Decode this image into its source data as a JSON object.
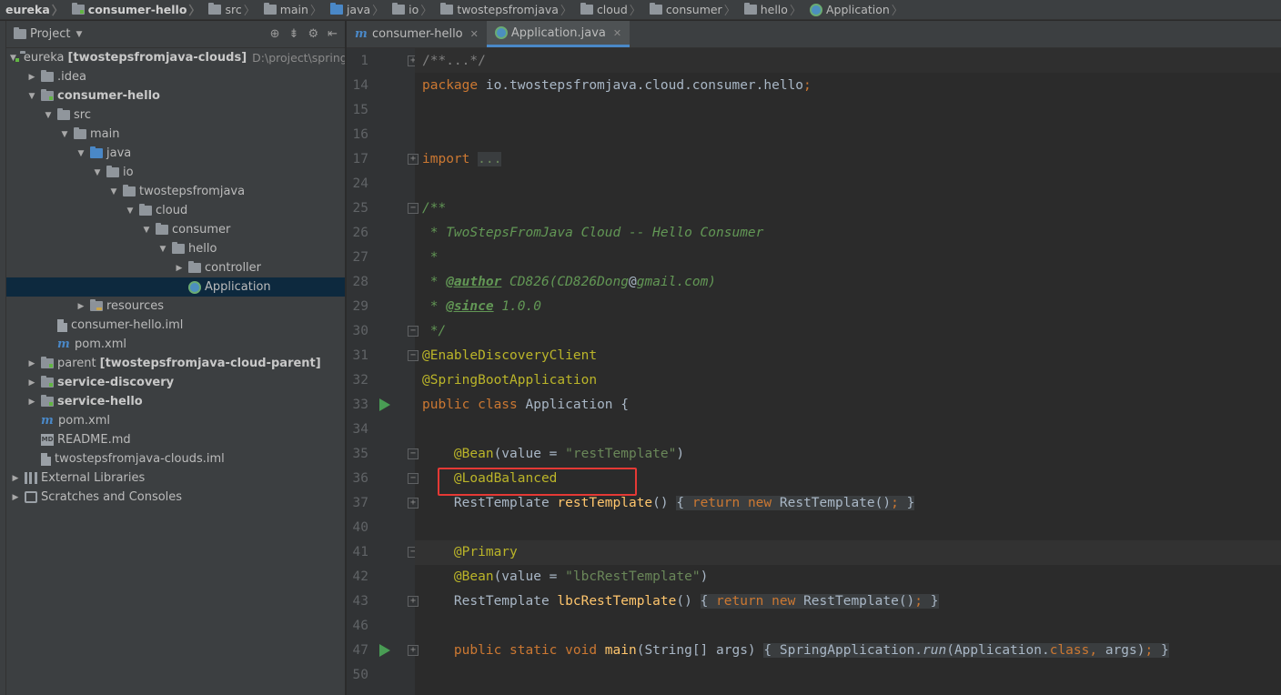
{
  "breadcrumb": [
    "eureka",
    "consumer-hello",
    "src",
    "main",
    "java",
    "io",
    "twostepsfromjava",
    "cloud",
    "consumer",
    "hello",
    "Application"
  ],
  "project_panel": {
    "title": "Project",
    "tree": [
      {
        "label": "eureka",
        "suffix": "[twostepsfromjava-clouds]",
        "path": "D:\\project\\springClo",
        "depth": 0,
        "arrow": "open",
        "icon": "module"
      },
      {
        "label": ".idea",
        "depth": 1,
        "arrow": "closed",
        "icon": "folder"
      },
      {
        "label": "consumer-hello",
        "depth": 1,
        "arrow": "open",
        "icon": "module",
        "bold": true
      },
      {
        "label": "src",
        "depth": 2,
        "arrow": "open",
        "icon": "folder"
      },
      {
        "label": "main",
        "depth": 3,
        "arrow": "open",
        "icon": "folder"
      },
      {
        "label": "java",
        "depth": 4,
        "arrow": "open",
        "icon": "folder-blue"
      },
      {
        "label": "io",
        "depth": 5,
        "arrow": "open",
        "icon": "folder"
      },
      {
        "label": "twostepsfromjava",
        "depth": 6,
        "arrow": "open",
        "icon": "folder"
      },
      {
        "label": "cloud",
        "depth": 7,
        "arrow": "open",
        "icon": "folder"
      },
      {
        "label": "consumer",
        "depth": 8,
        "arrow": "open",
        "icon": "folder"
      },
      {
        "label": "hello",
        "depth": 9,
        "arrow": "open",
        "icon": "folder"
      },
      {
        "label": "controller",
        "depth": 10,
        "arrow": "closed",
        "icon": "folder"
      },
      {
        "label": "Application",
        "depth": 10,
        "arrow": "none",
        "icon": "spring",
        "selected": true
      },
      {
        "label": "resources",
        "depth": 4,
        "arrow": "closed",
        "icon": "folder-res"
      },
      {
        "label": "consumer-hello.iml",
        "depth": 2,
        "arrow": "none",
        "icon": "file"
      },
      {
        "label": "pom.xml",
        "depth": 2,
        "arrow": "none",
        "icon": "maven"
      },
      {
        "label": "parent",
        "suffix": "[twostepsfromjava-cloud-parent]",
        "depth": 1,
        "arrow": "closed",
        "icon": "module"
      },
      {
        "label": "service-discovery",
        "depth": 1,
        "arrow": "closed",
        "icon": "module",
        "bold": true
      },
      {
        "label": "service-hello",
        "depth": 1,
        "arrow": "closed",
        "icon": "module",
        "bold": true
      },
      {
        "label": "pom.xml",
        "depth": 1,
        "arrow": "none",
        "icon": "maven"
      },
      {
        "label": "README.md",
        "depth": 1,
        "arrow": "none",
        "icon": "md"
      },
      {
        "label": "twostepsfromjava-clouds.iml",
        "depth": 1,
        "arrow": "none",
        "icon": "file"
      },
      {
        "label": "External Libraries",
        "depth": 0,
        "arrow": "closed",
        "icon": "libs"
      },
      {
        "label": "Scratches and Consoles",
        "depth": 0,
        "arrow": "closed",
        "icon": "scratch"
      }
    ]
  },
  "tabs": [
    {
      "label": "consumer-hello",
      "icon": "maven",
      "active": false
    },
    {
      "label": "Application.java",
      "icon": "spring",
      "active": true
    }
  ],
  "code_lines": [
    {
      "n": "1",
      "fold": "+",
      "html": "<span class='cm'>/**...*/</span>"
    },
    {
      "n": "14",
      "html": "<span class='kw'>package</span> io.twostepsfromjava.cloud.consumer.hello<span class='kw'>;</span>"
    },
    {
      "n": "15",
      "html": ""
    },
    {
      "n": "16",
      "html": ""
    },
    {
      "n": "17",
      "fold": "+",
      "html": "<span class='kw'>import</span> <span class='foldbox green'>...</span>"
    },
    {
      "n": "24",
      "html": ""
    },
    {
      "n": "25",
      "fold": "-",
      "html": "<span class='doc'>/**</span>"
    },
    {
      "n": "26",
      "html": "<span class='doc'> * TwoStepsFromJava Cloud -- Hello Consumer</span>"
    },
    {
      "n": "27",
      "html": "<span class='doc'> *</span>"
    },
    {
      "n": "28",
      "html": "<span class='doc'> * </span><span class='doctag'>@author</span><span class='doc'> CD826(CD826Dong</span><span style='color:#a9b7c6'>@</span><span class='doc'>gmail.com)</span>"
    },
    {
      "n": "29",
      "html": "<span class='doc'> * </span><span class='doctag'>@since</span><span class='doc'> 1.0.0</span>"
    },
    {
      "n": "30",
      "fold": "-",
      "html": "<span class='doc'> */</span>"
    },
    {
      "n": "31",
      "fold": "-",
      "html": "<span class='ann'>@EnableDiscoveryClient</span>"
    },
    {
      "n": "32",
      "html": "<span class='ann'>@SpringBootApplication</span>"
    },
    {
      "n": "33",
      "run": true,
      "html": "<span class='kw'>public class</span> Application {"
    },
    {
      "n": "34",
      "html": ""
    },
    {
      "n": "35",
      "fold": "-",
      "html": "    <span class='ann'>@Bean</span>(value = <span class='str'>\"restTemplate\"</span>)"
    },
    {
      "n": "36",
      "fold": "-",
      "html": "    <span class='ann'>@LoadBalanced</span>"
    },
    {
      "n": "37",
      "fold": "+",
      "html": "    RestTemplate <span class='fn'>restTemplate</span>() <span class='foldbox'>{ <span class='kw'>return new</span> RestTemplate()<span class='kw'>;</span> }</span>"
    },
    {
      "n": "40",
      "html": ""
    },
    {
      "n": "41",
      "fold": "-",
      "current": true,
      "html": "    <span class='ann'>@Primary</span>"
    },
    {
      "n": "42",
      "html": "    <span class='ann'>@Bean</span>(value = <span class='str'>\"lbcRestTemplate\"</span>)"
    },
    {
      "n": "43",
      "fold": "+",
      "html": "    RestTemplate <span class='fn'>lbcRestTemplate</span>() <span class='foldbox'>{ <span class='kw'>return new</span> RestTemplate()<span class='kw'>;</span> }</span>"
    },
    {
      "n": "46",
      "html": ""
    },
    {
      "n": "47",
      "fold": "+",
      "run": true,
      "html": "    <span class='kw'>public static void</span> <span class='fn'>main</span>(String[] args) <span class='foldbox'>{ SpringApplication.<span class='ital'>run</span>(Application.<span class='kw'>class,</span> args)<span class='kw'>;</span> }</span>"
    },
    {
      "n": "50",
      "html": ""
    }
  ]
}
